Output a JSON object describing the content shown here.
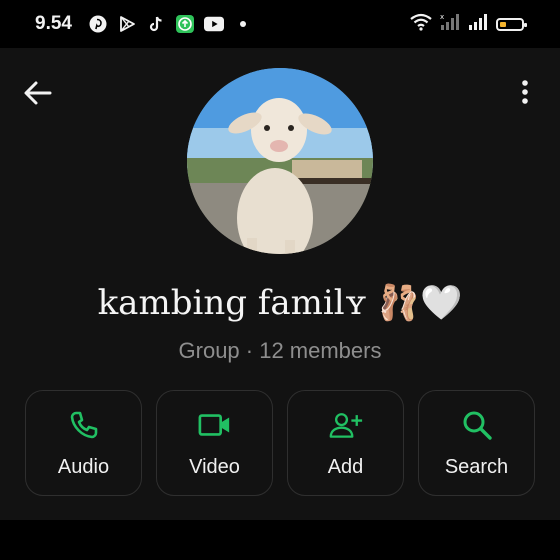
{
  "status_bar": {
    "time": "9.54",
    "app_icons": [
      "pinterest-icon",
      "play-store-icon",
      "tiktok-icon",
      "green-app-icon",
      "youtube-icon",
      "dot-icon"
    ],
    "indicators": [
      "wifi-icon",
      "signal-icon",
      "signal-icon",
      "battery-icon"
    ]
  },
  "header": {
    "back_icon": "arrow-left-icon",
    "menu_icon": "more-vertical-icon"
  },
  "group": {
    "name": "kambing familʏ 🩰🤍",
    "subtitle": "Group · 12 members"
  },
  "actions": [
    {
      "label": "Audio",
      "icon": "phone-icon"
    },
    {
      "label": "Video",
      "icon": "video-camera-icon"
    },
    {
      "label": "Add",
      "icon": "add-person-icon"
    },
    {
      "label": "Search",
      "icon": "search-icon"
    }
  ],
  "colors": {
    "background": "#121212",
    "accent": "#21c063",
    "subtitle": "#8e8e8e",
    "button_border": "#2f2f2f",
    "battery": "#f3b32e"
  }
}
